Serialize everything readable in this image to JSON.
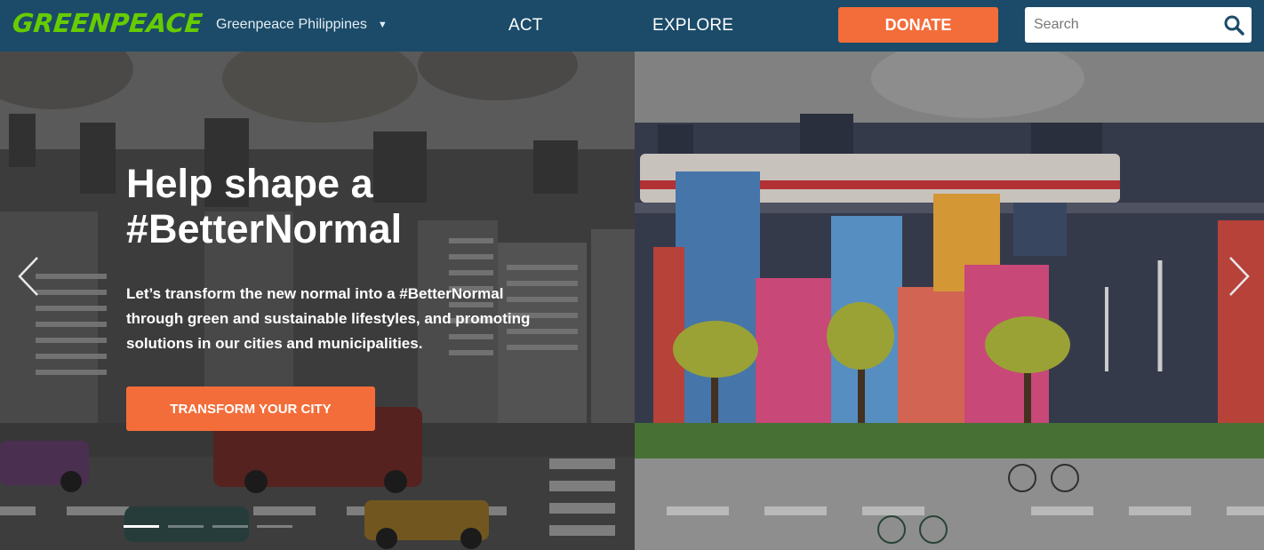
{
  "header": {
    "logo_text": "GREENPEACE",
    "region_label": "Greenpeace Philippines",
    "nav": {
      "act": "ACT",
      "explore": "EXPLORE"
    },
    "donate_label": "DONATE",
    "search": {
      "placeholder": "Search",
      "value": ""
    }
  },
  "hero": {
    "title_line1": "Help shape a",
    "title_line2": "#BetterNormal",
    "description": "Let’s transform the new normal into a #BetterNormal through green and sustainable lifestyles, and promoting solutions in our cities and municipalities.",
    "cta_label": "TRANSFORM YOUR CITY",
    "slides": [
      {
        "active": true
      },
      {
        "active": false
      },
      {
        "active": false
      },
      {
        "active": false
      }
    ]
  },
  "colors": {
    "nav_bg": "#1b4b69",
    "logo_green": "#66cc00",
    "accent_orange": "#f36d3a"
  }
}
